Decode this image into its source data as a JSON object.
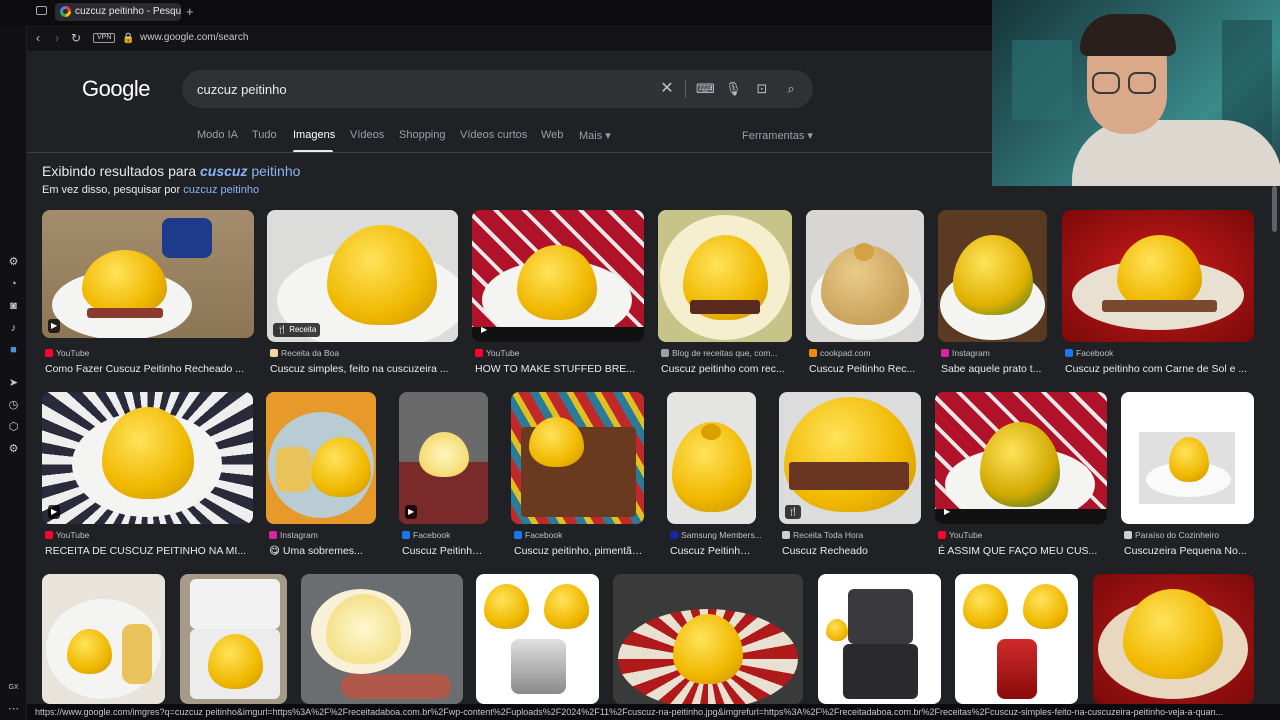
{
  "browser": {
    "tab_title": "cuzcuz peitinho - Pesquisa",
    "new_tab_glyph": "+",
    "vpn_label": "VPN",
    "url": "www.google.com/search",
    "gx_label": "GX"
  },
  "search": {
    "logo": "Google",
    "query": "cuzcuz peitinho",
    "tabs": [
      "Modo IA",
      "Tudo",
      "Imagens",
      "Vídeos",
      "Shopping",
      "Vídeos curtos",
      "Web",
      "Mais"
    ],
    "active_tab": "Imagens",
    "tools_label": "Ferramentas",
    "showing_prefix": "Exibindo resultados para",
    "showing_bold": "cuscuz",
    "showing_rest": "peitinho",
    "instead_prefix": "Em vez disso, pesquisar por",
    "instead_link": "cuzcuz peitinho"
  },
  "results": {
    "row1": [
      {
        "source": "YouTube",
        "title": "Como Fazer Cuscuz Peitinho Recheado ..."
      },
      {
        "source": "Receita da Boa",
        "title": "Cuscuz simples, feito na cuscuzeira ...",
        "badge": "Receita"
      },
      {
        "source": "YouTube",
        "title": "HOW TO MAKE STUFFED BRE..."
      },
      {
        "source": "Blog de receitas que, com...",
        "title": "Cuscuz peitinho com rec..."
      },
      {
        "source": "cookpad.com",
        "title": "Cuscuz Peitinho Rec..."
      },
      {
        "source": "Instagram",
        "title": "Sabe aquele prato t..."
      },
      {
        "source": "Facebook",
        "title": "Cuscuz peitinho com Carne de Sol e ..."
      }
    ],
    "row2": [
      {
        "source": "YouTube",
        "title": "RECEITA DE CUSCUZ PEITINHO NA MI..."
      },
      {
        "source": "Instagram",
        "title": "😋 Uma sobremes..."
      },
      {
        "source": "Facebook",
        "title": "Cuscuz Peitinho R..."
      },
      {
        "source": "Facebook",
        "title": "Cuscuz peitinho, pimentão..."
      },
      {
        "source": "Samsung Members...",
        "title": "Cuscuz Peitinho R..."
      },
      {
        "source": "Receita Toda Hora",
        "title": "Cuscuz Recheado"
      },
      {
        "source": "YouTube",
        "title": "É ASSIM QUE FAÇO MEU CUS..."
      },
      {
        "source": "Paraíso do Cozinheiro",
        "title": "Cuscuzeira Pequena No..."
      }
    ]
  },
  "status_url": "https://www.google.com/imgres?q=cuzcuz peitinho&imgurl=https%3A%2F%2Freceitadaboa.com.br%2Fwp-content%2Fuploads%2F2024%2F11%2Fcuscuz-na-peitinho.jpg&imgrefurl=https%3A%2F%2Freceitadaboa.com.br%2Freceitas%2Fcuscuz-simples-feito-na-cuscuzeira-peitinho-veja-a-quan...",
  "colors": {
    "link": "#8ab4f8",
    "page_bg": "#202124",
    "search_bg": "#303134"
  }
}
